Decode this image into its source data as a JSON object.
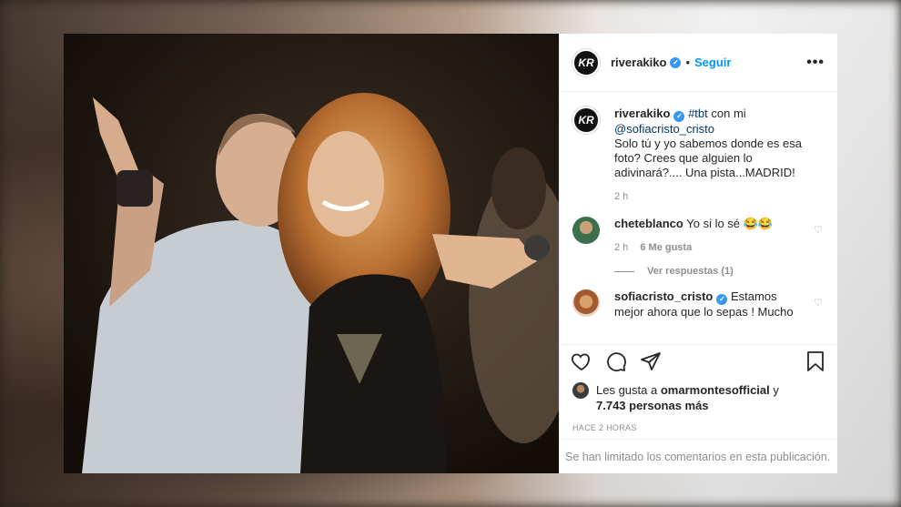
{
  "post": {
    "username": "riverakiko",
    "avatar_text": "KR",
    "follow_label": "Seguir",
    "more_label": "•••"
  },
  "caption": {
    "username": "riverakiko",
    "hashtag": "#tbt",
    "text_1": "con mi",
    "mention": "@sofiacristo_cristo",
    "text_2": "Solo tú y yo sabemos donde es esa foto? Crees que alguien lo adivinará?.... Una pista...MADRID!",
    "time": "2 h"
  },
  "comments": [
    {
      "username": "cheteblanco",
      "text": "Yo si lo sé 😂😂",
      "time": "2 h",
      "likes": "6 Me gusta"
    },
    {
      "username": "sofiacristo_cristo",
      "text": "Estamos mejor ahora que lo sepas ! Mucho"
    }
  ],
  "replies_label": "Ver respuestas (1)",
  "likes": {
    "prefix": "Les gusta a",
    "user": "omarmontesofficial",
    "connector": "y",
    "count": "7.743 personas más"
  },
  "timestamp": "HACE 2 HORAS",
  "limited_notice": "Se han limitado los comentarios en esta publicación.",
  "colors": {
    "link": "#00376b",
    "follow": "#0095f6",
    "verified": "#3897f0"
  },
  "icons": [
    "heart-icon",
    "comment-icon",
    "share-icon",
    "bookmark-icon"
  ]
}
